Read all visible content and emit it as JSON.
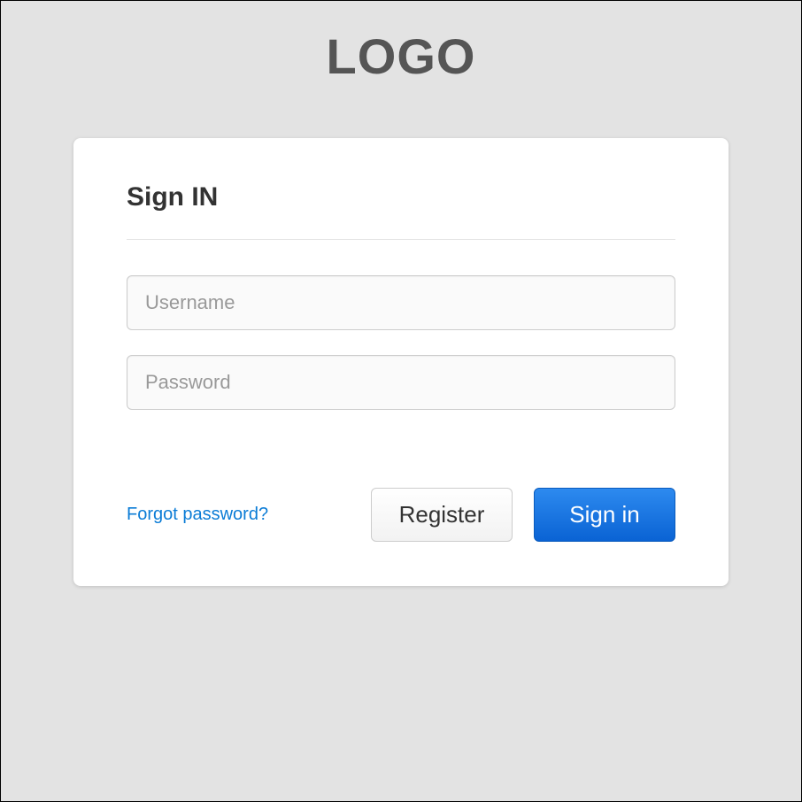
{
  "logo": {
    "text": "LOGO"
  },
  "card": {
    "title": "Sign IN"
  },
  "form": {
    "username_placeholder": "Username",
    "password_placeholder": "Password",
    "username_value": "",
    "password_value": ""
  },
  "actions": {
    "forgot_link_label": "Forgot password?",
    "register_label": "Register",
    "signin_label": "Sign in"
  }
}
